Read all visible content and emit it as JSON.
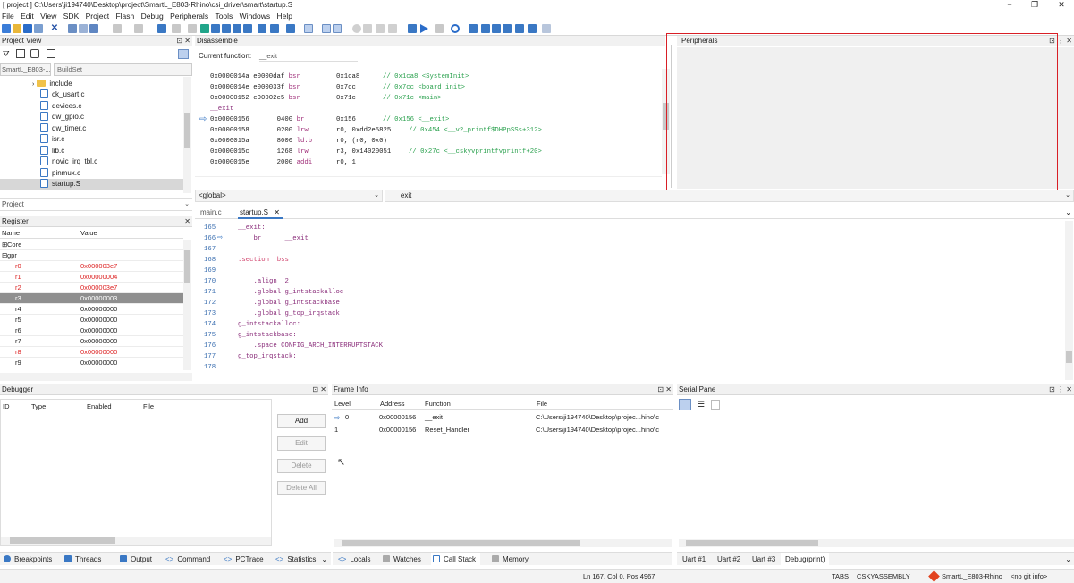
{
  "window": {
    "title": "[ project ] C:\\Users\\ji194740\\Desktop\\project\\SmartL_E803-Rhino\\csi_driver\\smart\\startup.S",
    "controls": [
      "−",
      "❐",
      "✕"
    ]
  },
  "menu": [
    "File",
    "Edit",
    "View",
    "SDK",
    "Project",
    "Flash",
    "Debug",
    "Peripherals",
    "Tools",
    "Windows",
    "Help"
  ],
  "project_view": {
    "title": "Project View",
    "project_select": "SmartL_E803-...",
    "buildset": "BuildSet",
    "folder": "include",
    "files": [
      "ck_usart.c",
      "devices.c",
      "dw_gpio.c",
      "dw_timer.c",
      "isr.c",
      "lib.c",
      "novic_irq_tbl.c",
      "pinmux.c",
      "startup.S"
    ],
    "bottom_label": "Project"
  },
  "register": {
    "title": "Register",
    "col_name": "Name",
    "col_value": "Value",
    "groups": [
      "Core",
      "gpr"
    ],
    "rows": [
      {
        "name": "r0",
        "value": "0x000003e7",
        "changed": true
      },
      {
        "name": "r1",
        "value": "0x00000004",
        "changed": true
      },
      {
        "name": "r2",
        "value": "0x000003e7",
        "changed": true
      },
      {
        "name": "r3",
        "value": "0x00000003",
        "selected": true
      },
      {
        "name": "r4",
        "value": "0x00000000"
      },
      {
        "name": "r5",
        "value": "0x00000000"
      },
      {
        "name": "r6",
        "value": "0x00000000"
      },
      {
        "name": "r7",
        "value": "0x00000000"
      },
      {
        "name": "r8",
        "value": "0x00000000",
        "changed": true
      },
      {
        "name": "r9",
        "value": "0x00000000"
      }
    ]
  },
  "disassemble": {
    "title": "Disassemble",
    "function_label": "Current function:",
    "function_value": "__exit",
    "lines": [
      {
        "addr": "0x0000014a",
        "code": "e0000daf",
        "op": "bsr",
        "args": "0x1ca8",
        "comment": "// 0x1ca8 <SystemInit>"
      },
      {
        "addr": "0x0000014e",
        "code": "e000033f",
        "op": "bsr",
        "args": "0x7cc",
        "comment": "// 0x7cc <board_init>"
      },
      {
        "addr": "0x00000152",
        "code": "e00002e5",
        "op": "bsr",
        "args": "0x71c",
        "comment": "// 0x71c <main>"
      },
      {
        "label": "__exit"
      },
      {
        "addr": "0x00000156",
        "code": "0400",
        "op": "br",
        "args": "0x156",
        "comment": "// 0x156 <__exit>",
        "current": true
      },
      {
        "addr": "0x00000158",
        "code": "0200",
        "op": "lrw",
        "args": "r0, 0xdd2e5825",
        "comment": "// 0x454 <__v2_printf$DHPpSSs+312>"
      },
      {
        "addr": "0x0000015a",
        "code": "8000",
        "op": "ld.b",
        "args": "r0, (r0, 0x0)",
        "comment": ""
      },
      {
        "addr": "0x0000015c",
        "code": "1268",
        "op": "lrw",
        "args": "r3, 0x14020051",
        "comment": "// 0x27c <__cskyvprintfvprintf+20>"
      },
      {
        "addr": "0x0000015e",
        "code": "2000",
        "op": "addi",
        "args": "r0, 1",
        "comment": ""
      }
    ],
    "scope": "<global>",
    "symbol": "__exit"
  },
  "editor": {
    "tabs": [
      "main.c",
      "startup.S"
    ],
    "close_glyph": "✕",
    "lines": [
      {
        "n": "165",
        "text": "__exit:"
      },
      {
        "n": "166",
        "text": "    br      __exit",
        "current": true
      },
      {
        "n": "167",
        "text": ""
      },
      {
        "n": "168",
        "text": ".section .bss"
      },
      {
        "n": "169",
        "text": ""
      },
      {
        "n": "170",
        "text": "    .align  2"
      },
      {
        "n": "171",
        "text": "    .global g_intstackalloc"
      },
      {
        "n": "172",
        "text": "    .global g_intstackbase"
      },
      {
        "n": "173",
        "text": "    .global g_top_irqstack"
      },
      {
        "n": "174",
        "text": "g_intstackalloc:"
      },
      {
        "n": "175",
        "text": "g_intstackbase:"
      },
      {
        "n": "176",
        "text": "    .space CONFIG_ARCH_INTERRUPTSTACK"
      },
      {
        "n": "177",
        "text": "g_top_irqstack:"
      },
      {
        "n": "178",
        "text": ""
      }
    ]
  },
  "peripherals": {
    "title": "Peripherals",
    "highlight_color": "#d81f26"
  },
  "debugger": {
    "title": "Debugger",
    "columns": [
      "ID",
      "Type",
      "Enabled",
      "File"
    ],
    "buttons": [
      "Add",
      "Edit",
      "Delete",
      "Delete All"
    ]
  },
  "frame_info": {
    "title": "Frame Info",
    "columns": [
      "Level",
      "Address",
      "Function",
      "File"
    ],
    "rows": [
      {
        "level": "0",
        "address": "0x00000156",
        "function": "__exit",
        "file": "C:\\Users\\ji194740\\Desktop\\projec...hino\\c"
      },
      {
        "level": "1",
        "address": "0x00000156",
        "function": "Reset_Handler",
        "file": "C:\\Users\\ji194740\\Desktop\\projec...hino\\c"
      }
    ]
  },
  "serial_pane": {
    "title": "Serial Pane"
  },
  "bottom_tabs": {
    "left": [
      "Breakpoints",
      "Threads",
      "Output",
      "Command",
      "PCTrace",
      "Statistics"
    ],
    "middle": [
      "Locals",
      "Watches",
      "Call Stack",
      "Memory"
    ],
    "right": [
      "Uart #1",
      "Uart #2",
      "Uart #3",
      "Debug(print)"
    ]
  },
  "statusbar": {
    "position": "Ln 167, Col 0, Pos 4967",
    "tabs": "TABS",
    "lang": "CSKYASSEMBLY",
    "project": "SmartL_E803-Rhino",
    "git": "<no git info>"
  }
}
